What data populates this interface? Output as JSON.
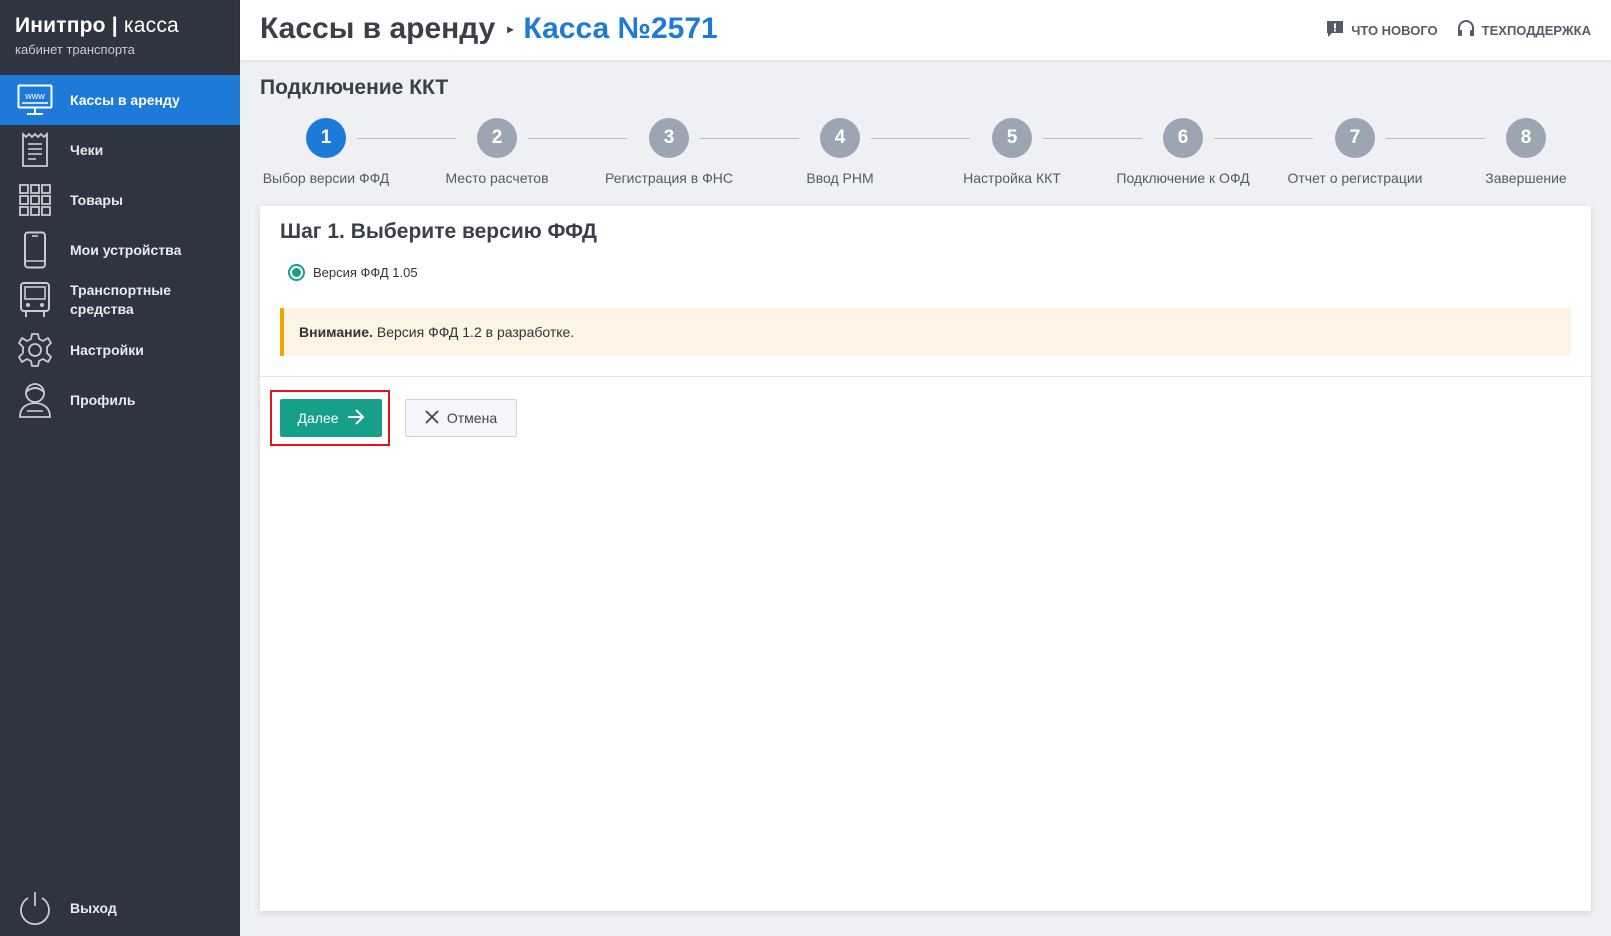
{
  "brand": {
    "name": "Инитпро",
    "sep": "|",
    "product": "касса",
    "subtitle": "кабинет транспорта"
  },
  "sidebar": {
    "items": [
      {
        "label": "Кассы в аренду",
        "icon": "www-monitor-icon",
        "active": true
      },
      {
        "label": "Чеки",
        "icon": "receipt-icon"
      },
      {
        "label": "Товары",
        "icon": "grid-icon"
      },
      {
        "label": "Мои устройства",
        "icon": "phone-icon"
      },
      {
        "label": "Транспортные средства",
        "icon": "bus-icon"
      },
      {
        "label": "Настройки",
        "icon": "gear-icon"
      },
      {
        "label": "Профиль",
        "icon": "user-icon"
      }
    ],
    "logout": {
      "label": "Выход",
      "icon": "power-icon"
    }
  },
  "header": {
    "breadcrumb_root": "Кассы в аренду",
    "breadcrumb_current": "Касса №2571",
    "whats_new": "ЧТО НОВОГО",
    "support": "ТЕХПОДДЕРЖКА"
  },
  "main": {
    "title": "Подключение ККТ",
    "steps": [
      {
        "num": "1",
        "label": "Выбор версии ФФД",
        "active": true
      },
      {
        "num": "2",
        "label": "Место расчетов"
      },
      {
        "num": "3",
        "label": "Регистрация в ФНС"
      },
      {
        "num": "4",
        "label": "Ввод РНМ"
      },
      {
        "num": "5",
        "label": "Настройка ККТ"
      },
      {
        "num": "6",
        "label": "Подключение к ОФД"
      },
      {
        "num": "7",
        "label": "Отчет о регистрации"
      },
      {
        "num": "8",
        "label": "Завершение"
      }
    ],
    "card": {
      "title": "Шаг 1. Выберите версию ФФД",
      "radio_label": "Версия ФФД 1.05",
      "radio_checked": true,
      "alert_bold": "Внимание.",
      "alert_text": "Версия ФФД 1.2 в разработке.",
      "next_label": "Далее",
      "cancel_label": "Отмена"
    }
  },
  "colors": {
    "sidebar_bg": "#2f3441",
    "accent": "#1e7ad8",
    "primary_button": "#16a08a",
    "alert_border": "#f0a500",
    "highlight": "#e0161e"
  }
}
